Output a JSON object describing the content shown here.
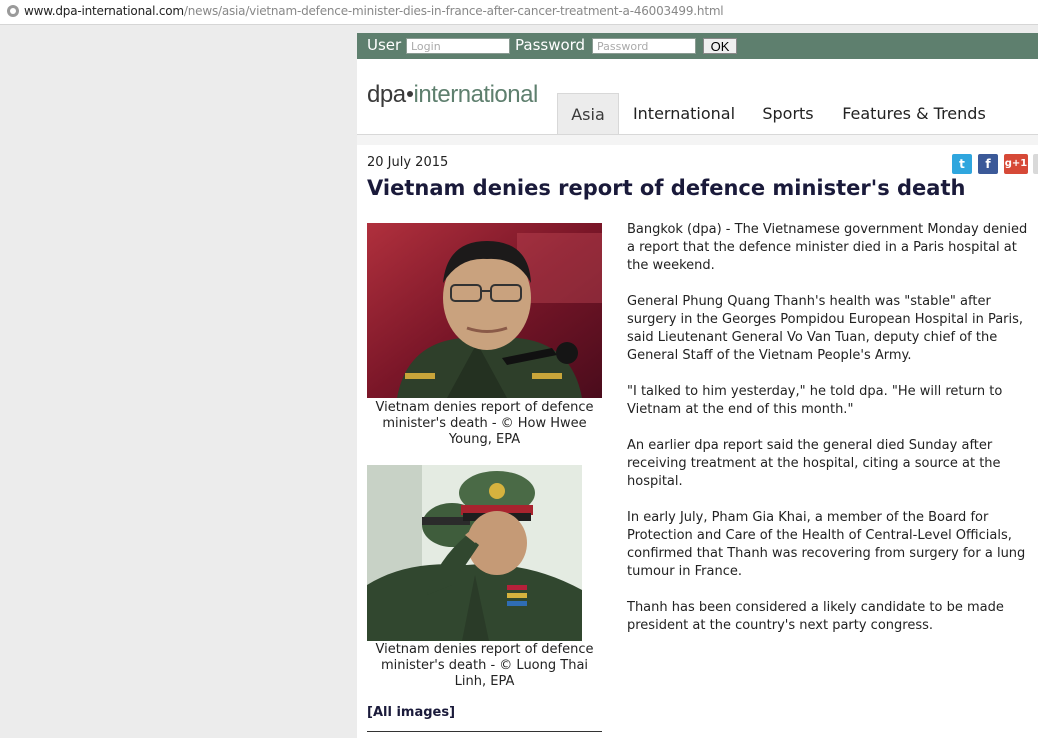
{
  "browser": {
    "url_domain": "www.dpa-international.com",
    "url_path": "/news/asia/vietnam-defence-minister-dies-in-france-after-cancer-treatment-a-46003499.html"
  },
  "login": {
    "user_label": "User",
    "user_placeholder": "Login",
    "password_label": "Password",
    "password_placeholder": "Password",
    "ok_label": "OK"
  },
  "logo": {
    "part1": "dpa",
    "part2": "international"
  },
  "nav": {
    "tabs": [
      {
        "label": "Asia",
        "active": true
      },
      {
        "label": "International"
      },
      {
        "label": "Sports"
      },
      {
        "label": "Features & Trends"
      }
    ]
  },
  "social": {
    "twitter": "t",
    "facebook": "f",
    "gplus": "g+1"
  },
  "article": {
    "date": "20 July 2015",
    "headline": "Vietnam denies report of defence minister's death",
    "images": [
      {
        "caption": "Vietnam denies report of defence minister's death - © How Hwee Young, EPA"
      },
      {
        "caption": "Vietnam denies report of defence minister's death - © Luong Thai Linh, EPA"
      }
    ],
    "all_images_label": "[All images]",
    "paragraphs": [
      "Bangkok (dpa) - The Vietnamese government Monday denied a report that the defence minister died in a Paris hospital at the weekend.",
      "General Phung Quang Thanh's health was \"stable\" after surgery in the Georges Pompidou European Hospital in Paris, said Lieutenant General Vo Van Tuan, deputy chief of the General Staff of the Vietnam People's Army.",
      "\"I talked to him yesterday,\" he told dpa. \"He will return to Vietnam at the end of this month.\"",
      "An earlier dpa report said the general died Sunday after receiving treatment at the hospital, citing a source at the hospital.",
      "In early July, Pham Gia Khai, a member of the Board for Protection and Care of the Health of Central-Level Officials, confirmed that Thanh was recovering from surgery for a lung tumour in France.",
      "Thanh has been considered a likely candidate to be made president at the country's next party congress."
    ]
  },
  "colors": {
    "brand_green": "#5e7f6e",
    "headline": "#1a1a3a"
  }
}
